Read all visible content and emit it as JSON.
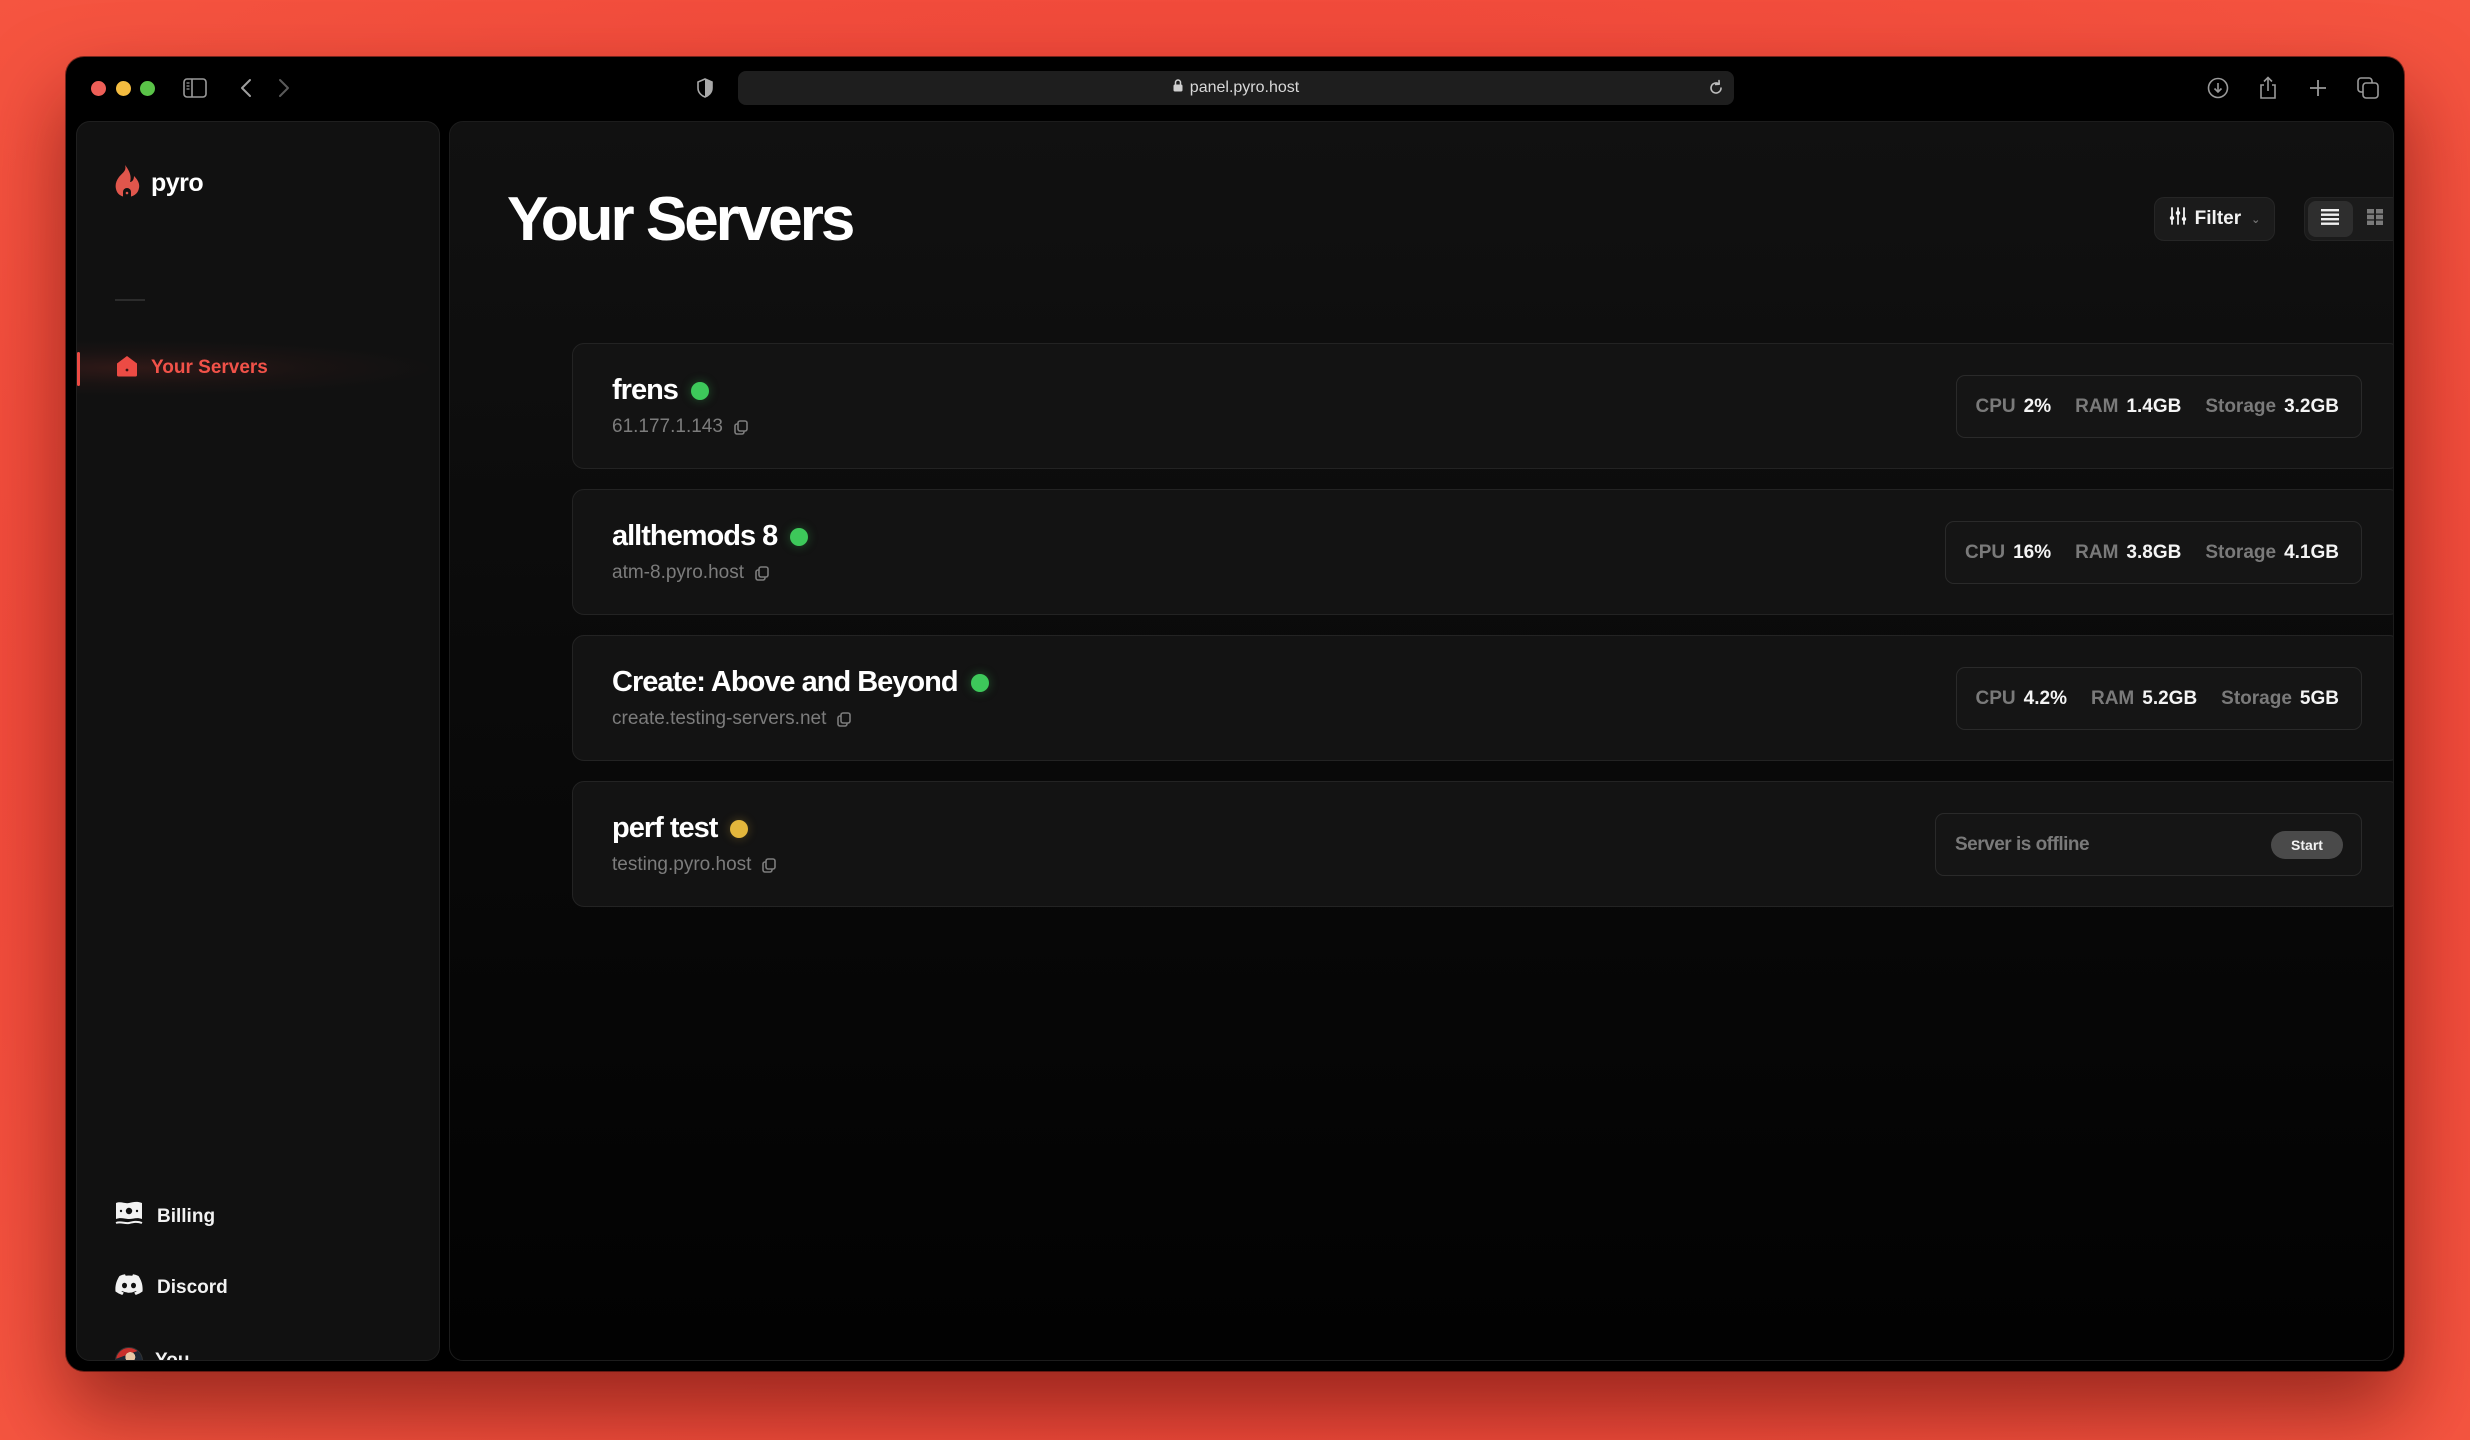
{
  "browser": {
    "url": "panel.pyro.host",
    "icons": [
      "sidebar-toggle-icon",
      "back-icon",
      "forward-icon",
      "privacy-shield-icon",
      "lock-icon",
      "reload-icon",
      "download-icon",
      "share-icon",
      "new-tab-icon",
      "tabs-overview-icon"
    ]
  },
  "sidebar": {
    "brand": "pyro",
    "nav": [
      {
        "label": "Your Servers",
        "icon": "home-icon",
        "active": true
      }
    ],
    "bottom": [
      {
        "label": "Billing",
        "icon": "money-icon"
      },
      {
        "label": "Discord",
        "icon": "discord-icon"
      },
      {
        "label": "You",
        "icon": "avatar"
      }
    ]
  },
  "main": {
    "title": "Your Servers",
    "filter_label": "Filter",
    "view_modes": [
      {
        "name": "list",
        "active": true
      },
      {
        "name": "grid",
        "active": false
      }
    ]
  },
  "servers": [
    {
      "name": "frens",
      "address": "61.177.1.143",
      "status": "online",
      "stats": [
        {
          "label": "CPU",
          "value": "2%"
        },
        {
          "label": "RAM",
          "value": "1.4GB"
        },
        {
          "label": "Storage",
          "value": "3.2GB"
        }
      ]
    },
    {
      "name": "allthemods 8",
      "address": "atm-8.pyro.host",
      "status": "online",
      "stats": [
        {
          "label": "CPU",
          "value": "16%"
        },
        {
          "label": "RAM",
          "value": "3.8GB"
        },
        {
          "label": "Storage",
          "value": "4.1GB"
        }
      ]
    },
    {
      "name": "Create: Above and Beyond",
      "address": "create.testing-servers.net",
      "status": "online",
      "stats": [
        {
          "label": "CPU",
          "value": "4.2%"
        },
        {
          "label": "RAM",
          "value": "5.2GB"
        },
        {
          "label": "Storage",
          "value": "5GB"
        }
      ]
    },
    {
      "name": "perf test",
      "address": "testing.pyro.host",
      "status": "offline",
      "offline_text": "Server is offline",
      "start_label": "Start"
    }
  ],
  "colors": {
    "accent": "#ec4b44",
    "online": "#3dc85a",
    "offline": "#e3b63c",
    "background": "#f24a3c"
  }
}
